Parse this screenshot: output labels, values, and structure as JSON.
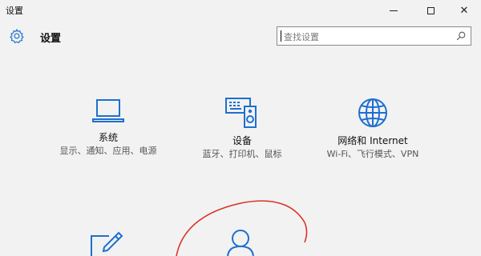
{
  "window": {
    "title": "设置",
    "controls": {
      "minimize": "minimize",
      "maximize": "maximize",
      "close": "✕"
    }
  },
  "header": {
    "title": "设置",
    "icon": "gear-icon"
  },
  "search": {
    "placeholder": "查找设置",
    "icon": "search-icon"
  },
  "tiles": [
    {
      "id": "system",
      "icon": "laptop-icon",
      "title": "系统",
      "desc": "显示、通知、应用、电源"
    },
    {
      "id": "devices",
      "icon": "devices-icon",
      "title": "设备",
      "desc": "蓝牙、打印机、鼠标"
    },
    {
      "id": "network",
      "icon": "globe-icon",
      "title": "网络和 Internet",
      "desc": "Wi-Fi、飞行模式、VPN"
    },
    {
      "id": "personalization",
      "icon": "personalization-icon"
    },
    {
      "id": "accounts",
      "icon": "person-icon"
    }
  ],
  "colors": {
    "accent": "#1e6fd0",
    "background": "#f2f2f2",
    "annotation": "#d9342b"
  }
}
